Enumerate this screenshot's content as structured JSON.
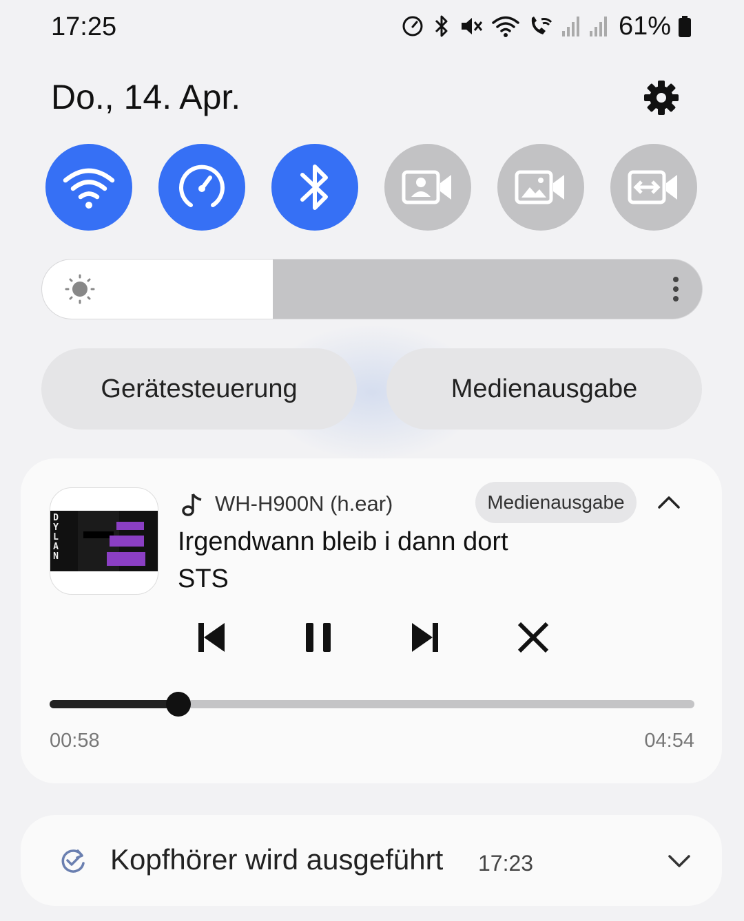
{
  "status_bar": {
    "time": "17:25",
    "battery_percent": "61%",
    "icons": [
      "speedometer-icon",
      "bluetooth-icon",
      "mute-icon",
      "wifi-icon",
      "wifi-call-icon",
      "signal-icon",
      "signal-icon",
      "battery-icon"
    ]
  },
  "header": {
    "date": "Do., 14. Apr.",
    "settings_icon": "gear-icon"
  },
  "quick_toggles": [
    {
      "icon": "wifi-icon",
      "active": true
    },
    {
      "icon": "speedometer-icon",
      "active": true
    },
    {
      "icon": "bluetooth-icon",
      "active": true
    },
    {
      "icon": "video-portrait-icon",
      "active": false
    },
    {
      "icon": "video-background-icon",
      "active": false
    },
    {
      "icon": "video-autoframing-icon",
      "active": false
    }
  ],
  "brightness": {
    "level": 0.35,
    "icon": "sun-icon",
    "more_icon": "more-vertical-icon"
  },
  "pills": {
    "device_control": "Gerätesteuerung",
    "media_output": "Medienausgabe"
  },
  "media": {
    "device_icon": "music-note-icon",
    "device": "WH-H900N (h.ear)",
    "output_badge": "Medienausgabe",
    "title": "Irgendwann bleib i dann dort",
    "artist": "STS",
    "album_art_text": "DYLAN",
    "elapsed": "00:58",
    "total": "04:54",
    "progress": 0.2
  },
  "notification": {
    "icon": "check-refresh-icon",
    "text": "Kopfhörer wird ausgeführt",
    "time": "17:23"
  },
  "colors": {
    "accent": "#3670f5",
    "inactive_tile": "#c2c2c4",
    "background": "#f2f2f4"
  }
}
